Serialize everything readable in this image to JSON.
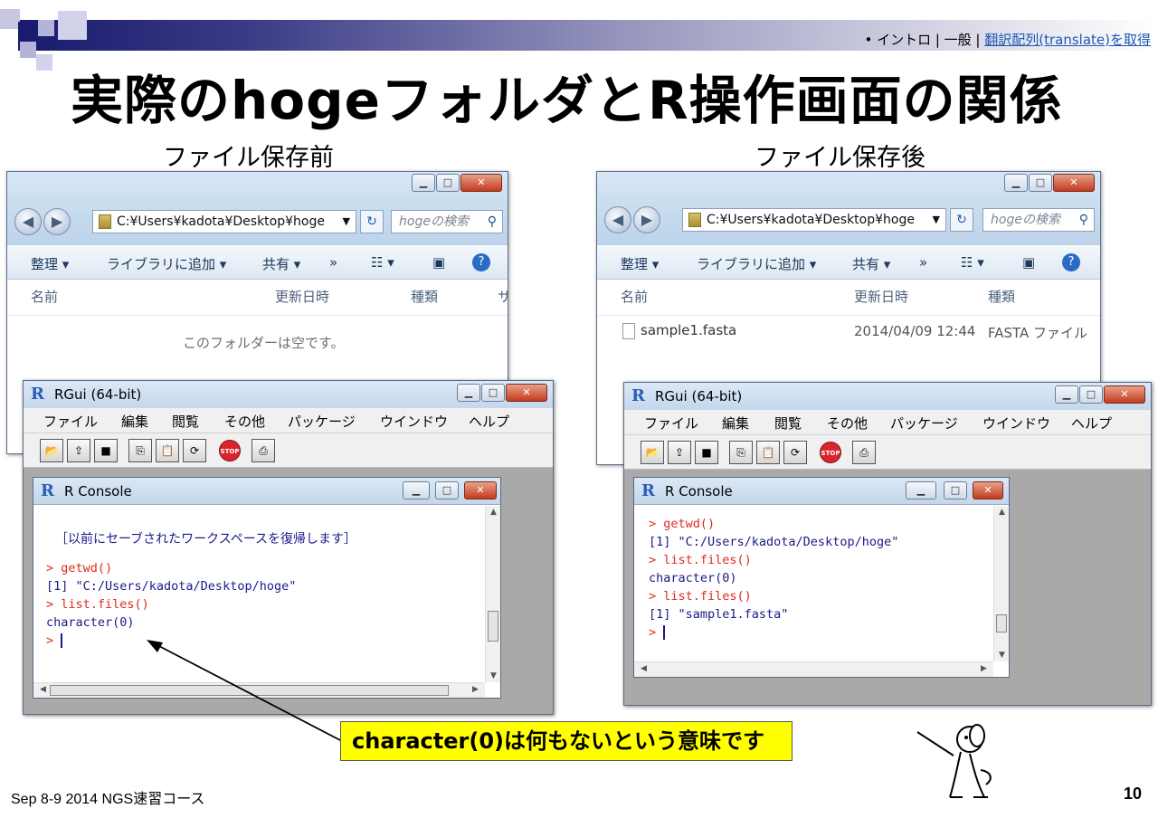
{
  "header": {
    "crumb_prefix": "• イントロ | 一般 | ",
    "crumb_link": "翻訳配列(translate)を取得",
    "title": "実際のhogeフォルダとR操作画面の関係"
  },
  "labels": {
    "before": "ファイル保存前",
    "after": "ファイル保存後"
  },
  "explorer": {
    "path": "C:¥Users¥kadota¥Desktop¥hoge",
    "search_placeholder": "hogeの検索",
    "cmd": {
      "organize": "整理 ▾",
      "add_library": "ライブラリに追加 ▾",
      "share": "共有 ▾",
      "more": "»"
    },
    "columns": {
      "name": "名前",
      "modified": "更新日時",
      "type": "種類",
      "extra": "サ"
    },
    "empty_msg": "このフォルダーは空です。",
    "file": {
      "name": "sample1.fasta",
      "modified": "2014/04/09 12:44",
      "type": "FASTA ファイル"
    }
  },
  "rgui": {
    "title": "RGui (64-bit)",
    "menu": [
      "ファイル",
      "編集",
      "閲覧",
      "その他",
      "パッケージ",
      "ウインドウ",
      "ヘルプ"
    ],
    "console_title": "R Console",
    "stop_label": "STOP"
  },
  "console_left": {
    "notice": "［以前にセーブされたワークスペースを復帰します］",
    "lines": [
      "> getwd()",
      "[1] \"C:/Users/kadota/Desktop/hoge\"",
      "> list.files()",
      "character(0)",
      ">"
    ]
  },
  "console_right": {
    "lines": [
      "> getwd()",
      "[1] \"C:/Users/kadota/Desktop/hoge\"",
      "> list.files()",
      "character(0)",
      "> list.files()",
      "[1] \"sample1.fasta\"",
      ">"
    ]
  },
  "callout": "character(0)は何もないという意味です",
  "footer": "Sep 8-9 2014 NGS速習コース",
  "page_number": "10"
}
